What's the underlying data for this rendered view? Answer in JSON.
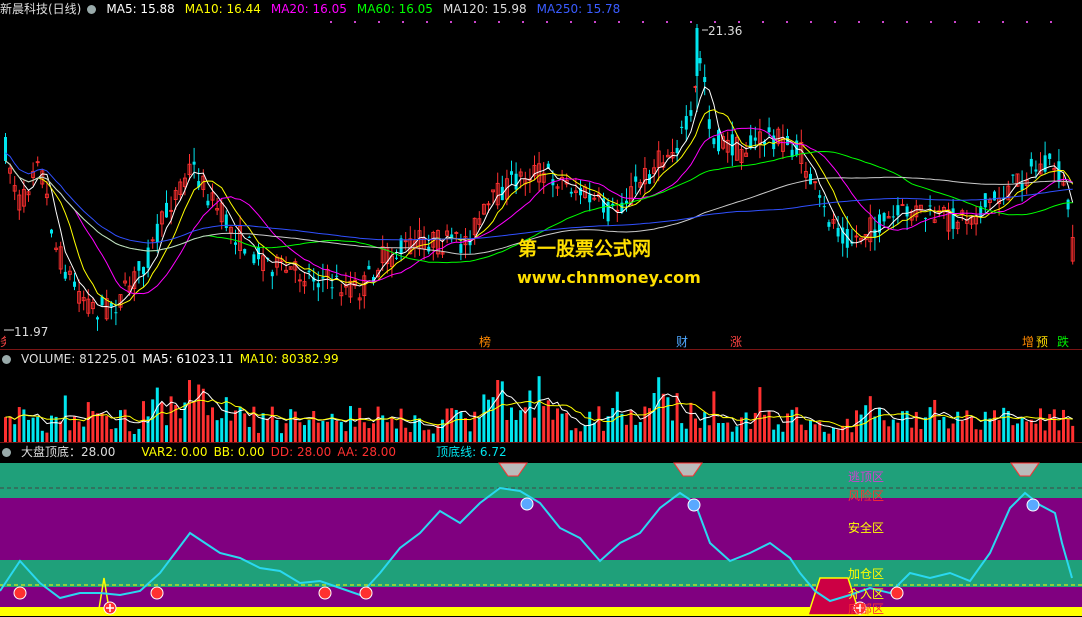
{
  "price_header": {
    "name": "新晨科技(日线)",
    "ma5": "MA5: 15.88",
    "ma10": "MA10: 16.44",
    "ma20": "MA20: 16.05",
    "ma60": "MA60: 16.05",
    "ma120": "MA120: 15.98",
    "ma250": "MA250: 15.78"
  },
  "price_labels": {
    "high": "21.36",
    "low": "11.97"
  },
  "watermark": {
    "line1": "第一股票公式网",
    "line2": "www.chnmoney.com"
  },
  "event_tags": [
    {
      "text": "榜",
      "color": "#ff8800"
    },
    {
      "text": "财",
      "color": "#4fa8ff"
    },
    {
      "text": "涨",
      "color": "#ff4444"
    },
    {
      "text": "增",
      "color": "#ff8800"
    },
    {
      "text": "预",
      "color": "#ffdd00"
    },
    {
      "text": "跌",
      "color": "#00ee00"
    },
    {
      "text": "务",
      "color": "#ff4444"
    }
  ],
  "volume_header": {
    "volume": "VOLUME: 81225.01",
    "ma5": "MA5: 61023.11",
    "ma10": "MA10: 80382.99"
  },
  "indicator_header": {
    "name": "大盘顶底：28.00",
    "var2": "VAR2: 0.00",
    "bb": "BB: 0.00",
    "dd": "DD: 28.00",
    "aa": "AA: 28.00",
    "line": "顶底线: 6.72"
  },
  "zones": {
    "escape": "逃顶区",
    "risk": "风险区",
    "safe": "安全区",
    "addpos": "加仓区",
    "entry": "介入区",
    "bottom": "底部区"
  },
  "colors": {
    "up": "#ff3030",
    "down": "#00e5ee",
    "ma5": "#ffffff",
    "ma10": "#ffff00",
    "ma20": "#ff00ff",
    "ma60": "#00ff00",
    "ma120": "#cccccc",
    "ma250": "#3050ff",
    "teal": "#1fa07a",
    "purple": "#800080"
  }
}
